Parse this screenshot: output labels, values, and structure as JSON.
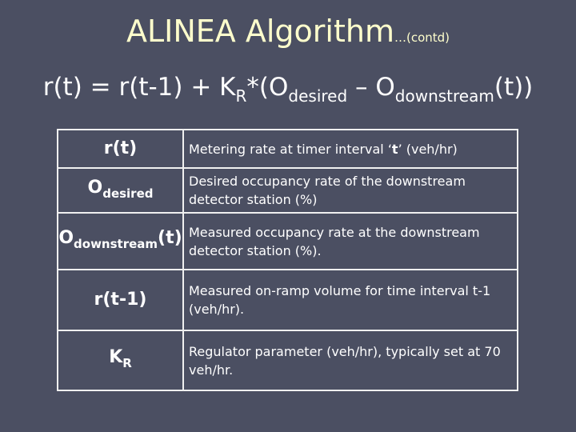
{
  "title": {
    "main": "ALINEA Algorithm",
    "suffix": "…(contd)"
  },
  "formula": {
    "p1": "r(t) = r(t-1) + K",
    "sub1": "R",
    "p2": "*(O",
    "sub2": "desired",
    "p3": " – O",
    "sub3": "downstream",
    "p4": "(t))"
  },
  "rows": [
    {
      "sym": "r(t)",
      "desc_pre": "Metering rate at timer interval ‘",
      "desc_bold": "t",
      "desc_post": "’ (veh/hr)"
    },
    {
      "sym": "O",
      "sub": "desired",
      "desc": "Desired occupancy rate of the downstream detector station (%)"
    },
    {
      "sym": "O",
      "sub": "downstream",
      "sym_post": "(t)",
      "desc": "Measured occupancy rate at the downstream detector station (%)."
    },
    {
      "sym": "r(t-1)",
      "desc": "Measured on-ramp volume for time interval t-1 (veh/hr)."
    },
    {
      "sym": "K",
      "sub": "R",
      "desc": "Regulator parameter (veh/hr), typically set at 70 veh/hr."
    }
  ],
  "colors": {
    "background": "#4b4f62",
    "title": "#ffffcc",
    "text": "#ffffff"
  }
}
